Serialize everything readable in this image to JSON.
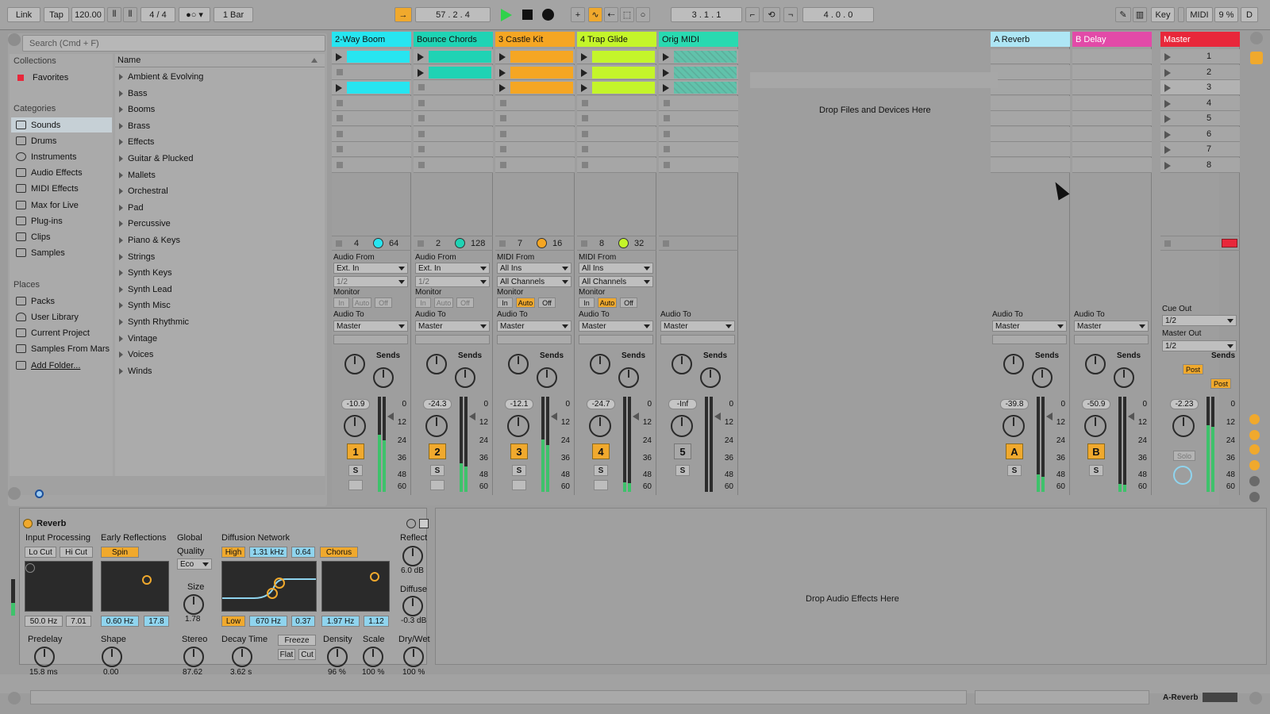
{
  "topbar": {
    "link": "Link",
    "tap": "Tap",
    "tempo": "120.00",
    "metronome_icon": "bars-icon",
    "signature": "4 / 4",
    "rec_mode": "1 Bar",
    "position": "57 .  2 .  4",
    "loop_start": "3 .  1 .  1",
    "loop_length": "4 .  0 .  0",
    "key": "Key",
    "midi": "MIDI",
    "cpu": "9 %",
    "d": "D"
  },
  "browser": {
    "search_placeholder": "Search (Cmd + F)",
    "collections_label": "Collections",
    "favorites": "Favorites",
    "categories_label": "Categories",
    "categories": [
      "Sounds",
      "Drums",
      "Instruments",
      "Audio Effects",
      "MIDI Effects",
      "Max for Live",
      "Plug-ins",
      "Clips",
      "Samples"
    ],
    "places_label": "Places",
    "places": [
      "Packs",
      "User Library",
      "Current Project",
      "Samples From Mars",
      "Add Folder..."
    ],
    "name_header": "Name",
    "items": [
      "Ambient & Evolving",
      "Bass",
      "Booms",
      "Brass",
      "Effects",
      "Guitar & Plucked",
      "Mallets",
      "Orchestral",
      "Pad",
      "Percussive",
      "Piano & Keys",
      "Strings",
      "Synth Keys",
      "Synth Lead",
      "Synth Misc",
      "Synth Rhythmic",
      "Vintage",
      "Voices",
      "Winds"
    ]
  },
  "tracks": [
    {
      "name": "2-Way Boom",
      "color": "#27e5f0",
      "n1": "4",
      "n2": "64",
      "from_label": "Audio From",
      "from": "Ext. In",
      "ch": "1/2",
      "monitor": "Monitor",
      "to_label": "Audio To",
      "to": "Master",
      "vol": "-10.9",
      "num": "1",
      "sends": "Sends"
    },
    {
      "name": "Bounce Chords",
      "color": "#1fd3b4",
      "n1": "2",
      "n2": "128",
      "from_label": "Audio From",
      "from": "Ext. In",
      "ch": "1/2",
      "monitor": "Monitor",
      "to_label": "Audio To",
      "to": "Master",
      "vol": "-24.3",
      "num": "2",
      "sends": "Sends"
    },
    {
      "name": "3 Castle Kit",
      "color": "#f5a623",
      "n1": "7",
      "n2": "16",
      "from_label": "MIDI From",
      "from": "All Ins",
      "ch": "All Channels",
      "monitor": "Monitor",
      "to_label": "Audio To",
      "to": "Master",
      "vol": "-12.1",
      "num": "3",
      "sends": "Sends"
    },
    {
      "name": "4 Trap Glide",
      "color": "#c4f52a",
      "n1": "8",
      "n2": "32",
      "from_label": "MIDI From",
      "from": "All Ins",
      "ch": "All Channels",
      "monitor": "Monitor",
      "to_label": "Audio To",
      "to": "Master",
      "vol": "-24.7",
      "num": "4",
      "sends": "Sends"
    },
    {
      "name": "Orig MIDI",
      "color": "#29d9b0",
      "to_label": "Audio To",
      "to": "Master",
      "vol": "-Inf",
      "num": "5",
      "sends": "Sends"
    }
  ],
  "monitor_opts": [
    "In",
    "Auto",
    "Off"
  ],
  "drop_files": "Drop Files and Devices Here",
  "returns": [
    {
      "name": "A Reverb",
      "color": "#aee6f5",
      "to_label": "Audio To",
      "to": "Master",
      "vol": "-39.8",
      "num": "A",
      "sends": "Sends"
    },
    {
      "name": "B Delay",
      "color": "#e24aa8",
      "to_label": "Audio To",
      "to": "Master",
      "vol": "-50.9",
      "num": "B",
      "sends": "Sends"
    }
  ],
  "master": {
    "name": "Master",
    "color": "#e8273a",
    "scenes": [
      "1",
      "2",
      "3",
      "4",
      "5",
      "6",
      "7",
      "8"
    ],
    "cue_label": "Cue Out",
    "cue": "1/2",
    "out_label": "Master Out",
    "out": "1/2",
    "vol": "-2.23",
    "sends": "Sends",
    "post": "Post",
    "solo": "Solo"
  },
  "scale": [
    "0",
    "12",
    "24",
    "36",
    "48",
    "60"
  ],
  "s_label": "S",
  "reverb": {
    "title": "Reverb",
    "input_processing": "Input Processing",
    "lo_cut": "Lo Cut",
    "hi_cut": "Hi Cut",
    "freq1": "50.0 Hz",
    "q1": "7.01",
    "early": "Early Reflections",
    "spin": "Spin",
    "freq2": "0.60 Hz",
    "amt2": "17.8",
    "global": "Global",
    "quality": "Quality",
    "quality_val": "Eco",
    "size": "Size",
    "size_val": "1.78",
    "diffusion": "Diffusion Network",
    "high": "High",
    "hfreq": "1.31 kHz",
    "hval": "0.64",
    "chorus": "Chorus",
    "low": "Low",
    "lfreq": "670 Hz",
    "lval": "0.37",
    "cfreq": "1.97 Hz",
    "cval": "1.12",
    "reflect": "Reflect",
    "reflect_val": "6.0 dB",
    "diffuse": "Diffuse",
    "diffuse_val": "-0.3 dB",
    "predelay": "Predelay",
    "predelay_val": "15.8 ms",
    "shape": "Shape",
    "shape_val": "0.00",
    "stereo": "Stereo",
    "stereo_val": "87.62",
    "decay": "Decay Time",
    "decay_val": "3.62 s",
    "freeze": "Freeze",
    "flat": "Flat",
    "cut": "Cut",
    "density": "Density",
    "density_val": "96 %",
    "scale": "Scale",
    "scale_val": "100 %",
    "drywet": "Dry/Wet",
    "drywet_val": "100 %"
  },
  "drop_fx": "Drop Audio Effects Here",
  "status_track": "A-Reverb"
}
